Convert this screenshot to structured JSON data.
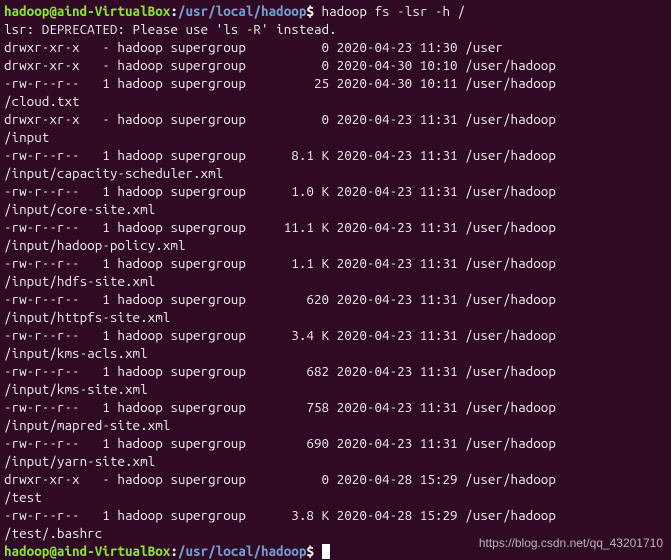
{
  "prompt": {
    "user": "hadoop@aind-VirtualBox",
    "colon": ":",
    "path": "/usr/local/hadoop",
    "dollar": "$"
  },
  "command": " hadoop fs -lsr -h /",
  "deprecated": "lsr: DEPRECATED: Please use 'ls -R' instead.",
  "entries": [
    {
      "perms": "drwxr-xr-x",
      "links": "-",
      "owner": "hadoop",
      "group": "supergroup",
      "size": "0",
      "date": "2020-04-23",
      "time": "11:30",
      "path": "/user",
      "wrap": null
    },
    {
      "perms": "drwxr-xr-x",
      "links": "-",
      "owner": "hadoop",
      "group": "supergroup",
      "size": "0",
      "date": "2020-04-30",
      "time": "10:10",
      "path": "/user/hadoop",
      "wrap": null
    },
    {
      "perms": "-rw-r--r--",
      "links": "1",
      "owner": "hadoop",
      "group": "supergroup",
      "size": "25",
      "date": "2020-04-30",
      "time": "10:11",
      "path": "/user/hadoop",
      "wrap": "/cloud.txt"
    },
    {
      "perms": "drwxr-xr-x",
      "links": "-",
      "owner": "hadoop",
      "group": "supergroup",
      "size": "0",
      "date": "2020-04-23",
      "time": "11:31",
      "path": "/user/hadoop",
      "wrap": "/input"
    },
    {
      "perms": "-rw-r--r--",
      "links": "1",
      "owner": "hadoop",
      "group": "supergroup",
      "size": "8.1 K",
      "date": "2020-04-23",
      "time": "11:31",
      "path": "/user/hadoop",
      "wrap": "/input/capacity-scheduler.xml"
    },
    {
      "perms": "-rw-r--r--",
      "links": "1",
      "owner": "hadoop",
      "group": "supergroup",
      "size": "1.0 K",
      "date": "2020-04-23",
      "time": "11:31",
      "path": "/user/hadoop",
      "wrap": "/input/core-site.xml"
    },
    {
      "perms": "-rw-r--r--",
      "links": "1",
      "owner": "hadoop",
      "group": "supergroup",
      "size": "11.1 K",
      "date": "2020-04-23",
      "time": "11:31",
      "path": "/user/hadoop",
      "wrap": "/input/hadoop-policy.xml"
    },
    {
      "perms": "-rw-r--r--",
      "links": "1",
      "owner": "hadoop",
      "group": "supergroup",
      "size": "1.1 K",
      "date": "2020-04-23",
      "time": "11:31",
      "path": "/user/hadoop",
      "wrap": "/input/hdfs-site.xml"
    },
    {
      "perms": "-rw-r--r--",
      "links": "1",
      "owner": "hadoop",
      "group": "supergroup",
      "size": "620",
      "date": "2020-04-23",
      "time": "11:31",
      "path": "/user/hadoop",
      "wrap": "/input/httpfs-site.xml"
    },
    {
      "perms": "-rw-r--r--",
      "links": "1",
      "owner": "hadoop",
      "group": "supergroup",
      "size": "3.4 K",
      "date": "2020-04-23",
      "time": "11:31",
      "path": "/user/hadoop",
      "wrap": "/input/kms-acls.xml"
    },
    {
      "perms": "-rw-r--r--",
      "links": "1",
      "owner": "hadoop",
      "group": "supergroup",
      "size": "682",
      "date": "2020-04-23",
      "time": "11:31",
      "path": "/user/hadoop",
      "wrap": "/input/kms-site.xml"
    },
    {
      "perms": "-rw-r--r--",
      "links": "1",
      "owner": "hadoop",
      "group": "supergroup",
      "size": "758",
      "date": "2020-04-23",
      "time": "11:31",
      "path": "/user/hadoop",
      "wrap": "/input/mapred-site.xml"
    },
    {
      "perms": "-rw-r--r--",
      "links": "1",
      "owner": "hadoop",
      "group": "supergroup",
      "size": "690",
      "date": "2020-04-23",
      "time": "11:31",
      "path": "/user/hadoop",
      "wrap": "/input/yarn-site.xml"
    },
    {
      "perms": "drwxr-xr-x",
      "links": "-",
      "owner": "hadoop",
      "group": "supergroup",
      "size": "0",
      "date": "2020-04-28",
      "time": "15:29",
      "path": "/user/hadoop",
      "wrap": "/test"
    },
    {
      "perms": "-rw-r--r--",
      "links": "1",
      "owner": "hadoop",
      "group": "supergroup",
      "size": "3.8 K",
      "date": "2020-04-28",
      "time": "15:29",
      "path": "/user/hadoop",
      "wrap": "/test/.bashrc"
    }
  ],
  "watermark": "https://blog.csdn.net/qq_43201710"
}
